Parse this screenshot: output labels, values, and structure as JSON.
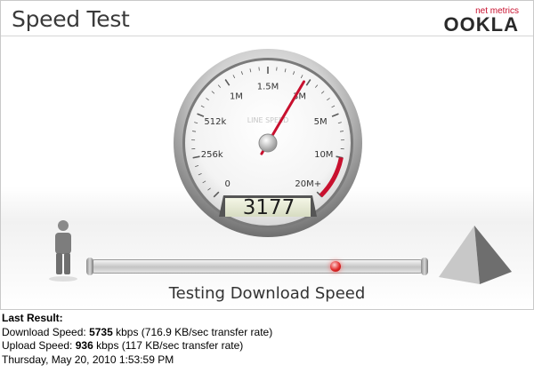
{
  "header": {
    "title": "Speed Test",
    "logo_tagline": "net metrics",
    "logo_name": "OOKLA"
  },
  "gauge": {
    "label": "LINE SPEED",
    "current_value": "3177",
    "ticks": [
      "0",
      "256k",
      "512k",
      "1M",
      "1.5M",
      "3M",
      "5M",
      "10M",
      "20M+"
    ],
    "needle_tick_position": 4.9,
    "colors": {
      "needle": "#c8102e",
      "redzone": "#c8102e"
    }
  },
  "test": {
    "status": "Testing Download Speed",
    "progress": 0.75
  },
  "icons": {
    "client": "person-icon",
    "server": "pyramid-icon"
  },
  "last_result": {
    "heading": "Last Result:",
    "download_label": "Download Speed: ",
    "download_value": "5735",
    "download_detail": " kbps (716.9 KB/sec transfer rate)",
    "upload_label": "Upload Speed: ",
    "upload_value": "936",
    "upload_detail": " kbps (117 KB/sec transfer rate)",
    "timestamp": "Thursday, May 20, 2010 1:53:59 PM"
  }
}
